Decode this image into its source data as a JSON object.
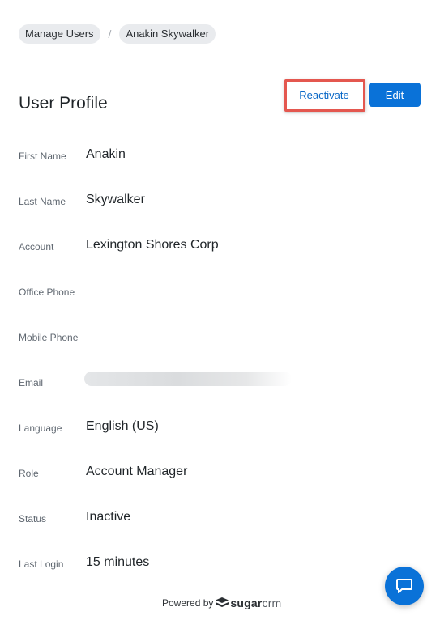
{
  "breadcrumb": {
    "items": [
      {
        "label": "Manage Users"
      },
      {
        "label": "Anakin Skywalker"
      }
    ],
    "separator": "/"
  },
  "header": {
    "title": "User Profile",
    "reactivate_label": "Reactivate",
    "edit_label": "Edit"
  },
  "fields": [
    {
      "label": "First Name",
      "value": "Anakin"
    },
    {
      "label": "Last Name",
      "value": "Skywalker"
    },
    {
      "label": "Account",
      "value": "Lexington Shores Corp"
    },
    {
      "label": "Office Phone",
      "value": ""
    },
    {
      "label": "Mobile Phone",
      "value": ""
    },
    {
      "label": "Email",
      "value": ""
    },
    {
      "label": "Language",
      "value": "English (US)"
    },
    {
      "label": "Role",
      "value": "Account Manager"
    },
    {
      "label": "Status",
      "value": "Inactive"
    },
    {
      "label": "Last Login",
      "value": "15 minutes"
    }
  ],
  "footer": {
    "powered_by": "Powered by",
    "brand_sugar": "sugar",
    "brand_crm": "crm"
  },
  "icons": {
    "chat": "chat-icon",
    "logo": "sugarcrm-logo-icon"
  },
  "colors": {
    "accent": "#0a72d8",
    "link": "#0a68c7",
    "highlight": "#e4574f",
    "chip_bg": "#e9ebee"
  }
}
